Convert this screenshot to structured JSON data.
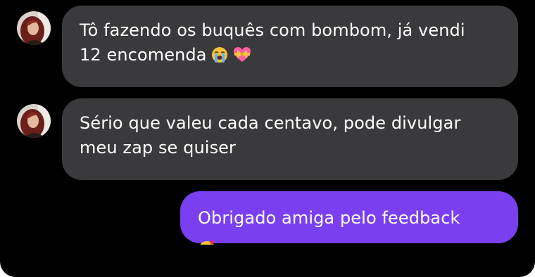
{
  "conversation": {
    "messages": [
      {
        "direction": "incoming",
        "lines": [
          "Tô fazendo os buquês com bombom, já vendi",
          "12 encomenda"
        ],
        "emojis": [
          "loudly-crying-face-emoji",
          "heart-with-ribbon-emoji"
        ]
      },
      {
        "direction": "incoming",
        "lines": [
          "Sério que valeu cada centavo, pode divulgar",
          "meu zap se quiser"
        ]
      },
      {
        "direction": "outgoing",
        "lines": [
          "Obrigado amiga pelo feedback"
        ],
        "emojis": [
          "smiling-face-with-hearts-emoji"
        ]
      }
    ]
  },
  "colors": {
    "background": "#000000",
    "incoming_bubble": "#3a3a3c",
    "outgoing_bubble": "#7a3ff0",
    "text": "#ffffff"
  }
}
